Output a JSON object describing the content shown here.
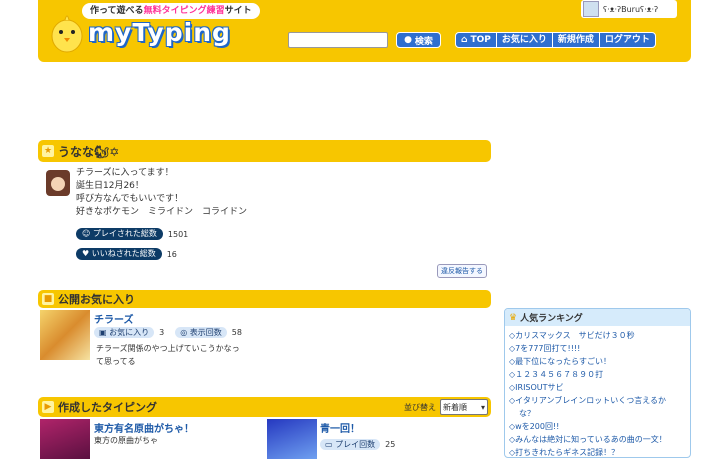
{
  "header": {
    "tagline_before": "作って遊べる",
    "tagline_free": "無料タイピング練習",
    "tagline_after": "サイト",
    "logo": "myTyping",
    "search_button": "検索",
    "nav": [
      "TOP",
      "お気に入り",
      "新規作成",
      "ログアウト"
    ],
    "user_name": "ʕ·ᴥ·ʔBuruʕ·ᴥ·ʔ"
  },
  "profile": {
    "name": "うなな🐿✡",
    "lines": [
      "チラーズに入ってます！",
      "誕生日12月26！",
      "呼び方なんでもいいです！",
      "好きなポケモン　ミライドン　コライドン"
    ],
    "play_label": "プレイされた総数",
    "play_count": "1501",
    "like_label": "いいねされた総数",
    "like_count": "16",
    "report": "違反報告する"
  },
  "favorites": {
    "title": "公開お気に入り",
    "card_title": "チラーズ",
    "fav_label": "お気に入り",
    "fav_count": "3",
    "view_label": "表示回数",
    "view_count": "58",
    "desc_1": "チラーズ関係のやつ上げていこうかなっ",
    "desc_2": "て思ってる"
  },
  "created": {
    "title": "作成したタイピング",
    "sort_label": "並び替え",
    "sort_value": "新着順",
    "card1_title": "東方有名原曲がちゃ！",
    "card1_desc": "東方の原曲がちゃ",
    "card2_title": "青一回！",
    "card2_play_label": "プレイ回数",
    "card2_play_count": "25"
  },
  "ranking": {
    "title": "人気ランキング",
    "items": [
      "カリスマックス　サビだけ３０秒",
      "7を777回打て!!!!",
      "最下位になったらすごい！",
      "１２３４５６７８９０打",
      "IRISOUTサビ",
      "イタリアンブレインロットいくつ言えるか",
      "な？",
      "wを200回!!",
      "みんなは絶対に知っているあの曲の一文！",
      "打ちきれたらギネス記録！？"
    ]
  }
}
